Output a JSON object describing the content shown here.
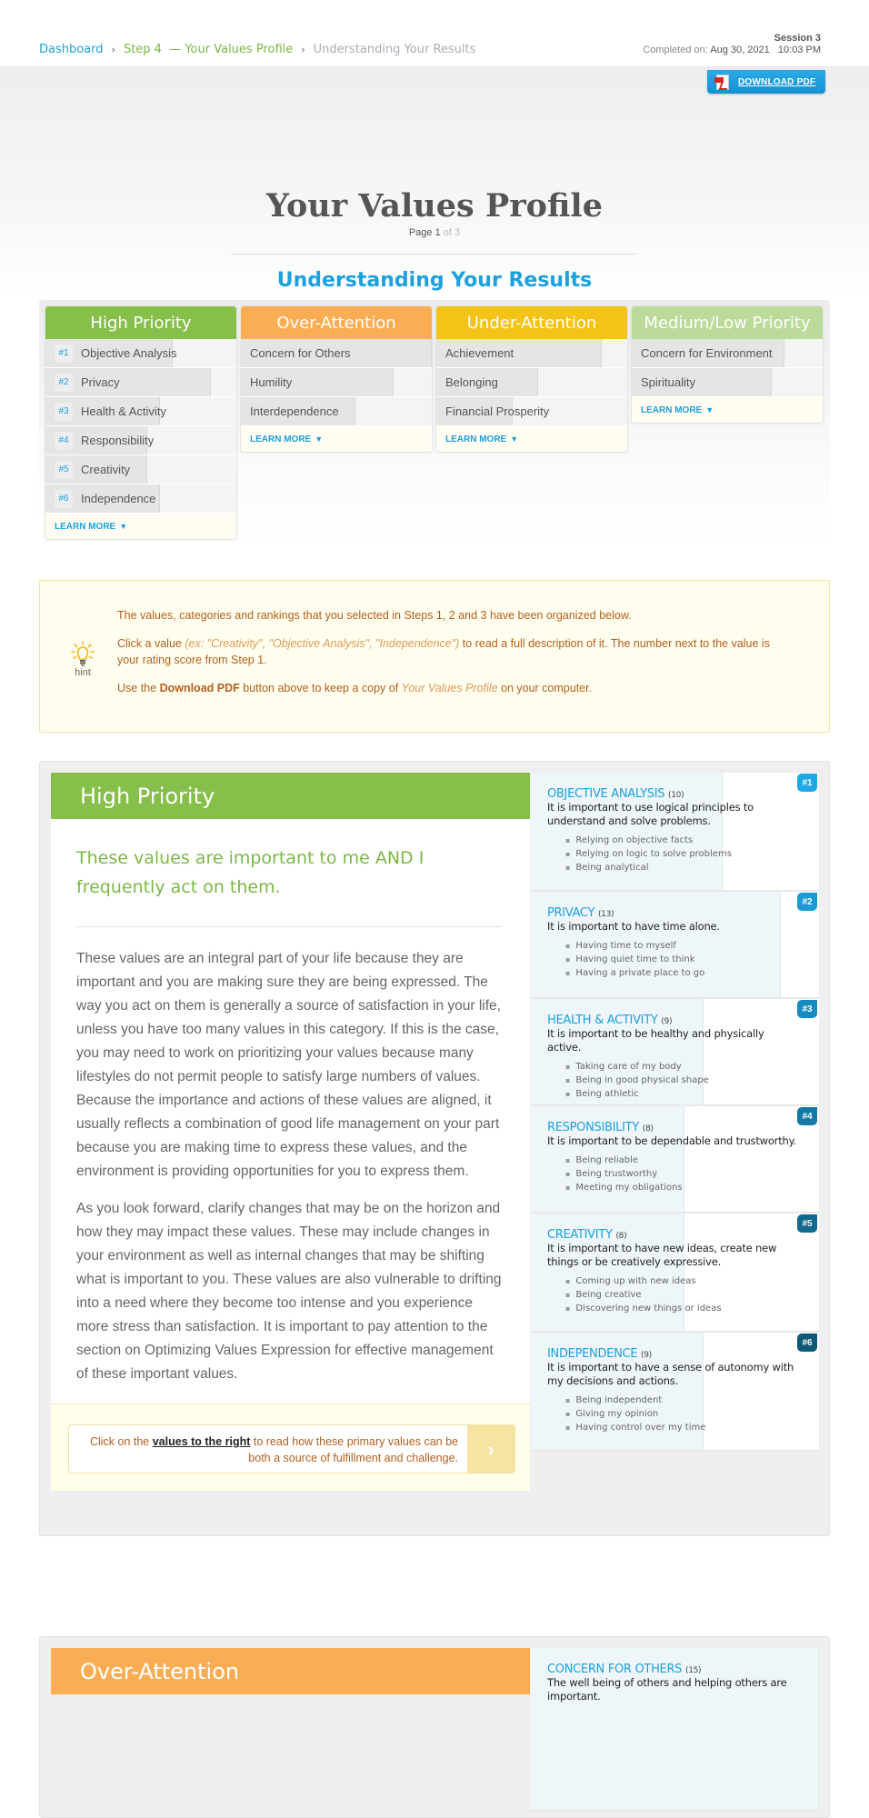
{
  "breadcrumb": {
    "dashboard": "Dashboard",
    "separator": "›",
    "step": "Step 4  — Your Values Profile",
    "current": "Understanding Your Results"
  },
  "session": {
    "label": "Session 3",
    "completed_prefix": "Completed on:",
    "completed_date": "Aug 30, 2021",
    "completed_time": "10:03 PM"
  },
  "download_pdf": {
    "label": "DOWNLOAD PDF",
    "icon": "pdf-icon"
  },
  "header": {
    "title": "Your Values Profile",
    "page_prefix": "Page",
    "page_current": "1",
    "page_total_text": "of 3",
    "subtitle": "Understanding Your Results"
  },
  "colors": {
    "high_priority": "#86bf4a",
    "over_attention": "#fbad53",
    "under_attention": "#f3c317",
    "medium_low": "#bcdb9a",
    "accent_blue": "#1ea0dc",
    "hint_text": "#b45f1e"
  },
  "summary": {
    "learn_more": "LEARN MORE",
    "learn_more_icon": "▼",
    "score_max": 15,
    "categories": [
      {
        "title": "High Priority",
        "values": [
          {
            "rank": "#1",
            "name": "Objective Analysis",
            "score": 10
          },
          {
            "rank": "#2",
            "name": "Privacy",
            "score": 13
          },
          {
            "rank": "#3",
            "name": "Health & Activity",
            "score": 9
          },
          {
            "rank": "#4",
            "name": "Responsibility",
            "score": 8
          },
          {
            "rank": "#5",
            "name": "Creativity",
            "score": 8
          },
          {
            "rank": "#6",
            "name": "Independence",
            "score": 9
          }
        ]
      },
      {
        "title": "Over-Attention",
        "values": [
          {
            "name": "Concern for Others",
            "score": 15
          },
          {
            "name": "Humility",
            "score": 12
          },
          {
            "name": "Interdependence",
            "score": 9
          }
        ]
      },
      {
        "title": "Under-Attention",
        "values": [
          {
            "name": "Achievement",
            "score": 13
          },
          {
            "name": "Belonging",
            "score": 8
          },
          {
            "name": "Financial Prosperity",
            "score": 6
          }
        ]
      },
      {
        "title": "Medium/Low Priority",
        "values": [
          {
            "name": "Concern for Environment",
            "score": 12
          },
          {
            "name": "Spirituality",
            "score": 11
          }
        ]
      }
    ]
  },
  "hint": {
    "label": "hint",
    "line1": "The values, categories and rankings that you selected in Steps 1, 2 and 3 have been organized below.",
    "line2_a": "Click a value ",
    "line2_example": "(ex: \"Creativity\", \"Objective Analysis\", \"Independence\")",
    "line2_b": " to read a full description of it. The number next to the value is your rating score from Step 1.",
    "line3_a": "Use the ",
    "line3_bold": "Download PDF",
    "line3_b": " button above to keep a copy of ",
    "line3_italic": "Your Values Profile",
    "line3_c": " on your computer."
  },
  "high_priority_section": {
    "title": "High Priority",
    "tagline": "These values are important to me AND I frequently act on them.",
    "paragraphs": [
      "These values are an integral part of your life because they are important and you are making sure they are being expressed. The way you act on them is generally a source of satisfaction in your life, unless you have too many values in this category. If this is the case, you may need to work on prioritizing your values because many lifestyles do not permit people to satisfy large numbers of values. Because the importance and actions of these values are aligned, it usually reflects a combination of good life management on your part because you are making time to express these values, and the environment is providing opportunities for you to express them.",
      "As you look forward, clarify changes that may be on the horizon and how they may impact these values. These may include changes in your environment as well as internal changes that may be shifting what is important to you. These values are also vulnerable to drifting into a need where they become too intense and you experience more stress than satisfaction. It is important to pay attention to the section on Optimizing Values Expression for effective management of these important values."
    ],
    "cta_a": "Click on the ",
    "cta_link": "values to the right",
    "cta_b": " to read how these primary values can be both a source of fulfillment and challenge.",
    "cta_arrow": "›",
    "values": [
      {
        "badge": "#1",
        "badge_color": "#1ea8e4",
        "name": "OBJECTIVE ANALYSIS",
        "score": "(10)",
        "score_value": 10,
        "desc": "It is important to use logical principles to understand and solve problems.",
        "items": [
          "Relying on objective facts",
          "Relying on logic to solve problems",
          "Being analytical"
        ]
      },
      {
        "badge": "#2",
        "badge_color": "#1b9ad6",
        "name": "PRIVACY",
        "score": "(13)",
        "score_value": 13,
        "desc": "It is important to have time alone.",
        "items": [
          "Having time to myself",
          "Having quiet time to think",
          "Having a private place to go"
        ]
      },
      {
        "badge": "#3",
        "badge_color": "#178cc0",
        "name": "HEALTH & ACTIVITY",
        "score": "(9)",
        "score_value": 9,
        "desc": "It is important to be healthy and physically active.",
        "items": [
          "Taking care of my body",
          "Being in good physical shape",
          "Being athletic"
        ]
      },
      {
        "badge": "#4",
        "badge_color": "#1479a6",
        "name": "RESPONSIBILITY",
        "score": "(8)",
        "score_value": 8,
        "desc": "It is important to be dependable and trustworthy.",
        "items": [
          "Being reliable",
          "Being trustworthy",
          "Meeting my obligations"
        ]
      },
      {
        "badge": "#5",
        "badge_color": "#11698f",
        "name": "CREATIVITY",
        "score": "(8)",
        "score_value": 8,
        "desc": "It is important to have new ideas, create new things or be creatively expressive.",
        "items": [
          "Coming up with new ideas",
          "Being creative",
          "Discovering new things or ideas"
        ]
      },
      {
        "badge": "#6",
        "badge_color": "#0e5878",
        "name": "INDEPENDENCE",
        "score": "(9)",
        "score_value": 9,
        "desc": "It is important to have a sense of autonomy with my decisions and actions.",
        "items": [
          "Being independent",
          "Giving my opinion",
          "Having control over my time"
        ]
      }
    ]
  },
  "over_attention_section": {
    "title": "Over-Attention",
    "values": [
      {
        "name": "CONCERN FOR OTHERS",
        "score": "(15)",
        "score_value": 15,
        "desc": "The well being of others and helping others are important."
      }
    ]
  }
}
